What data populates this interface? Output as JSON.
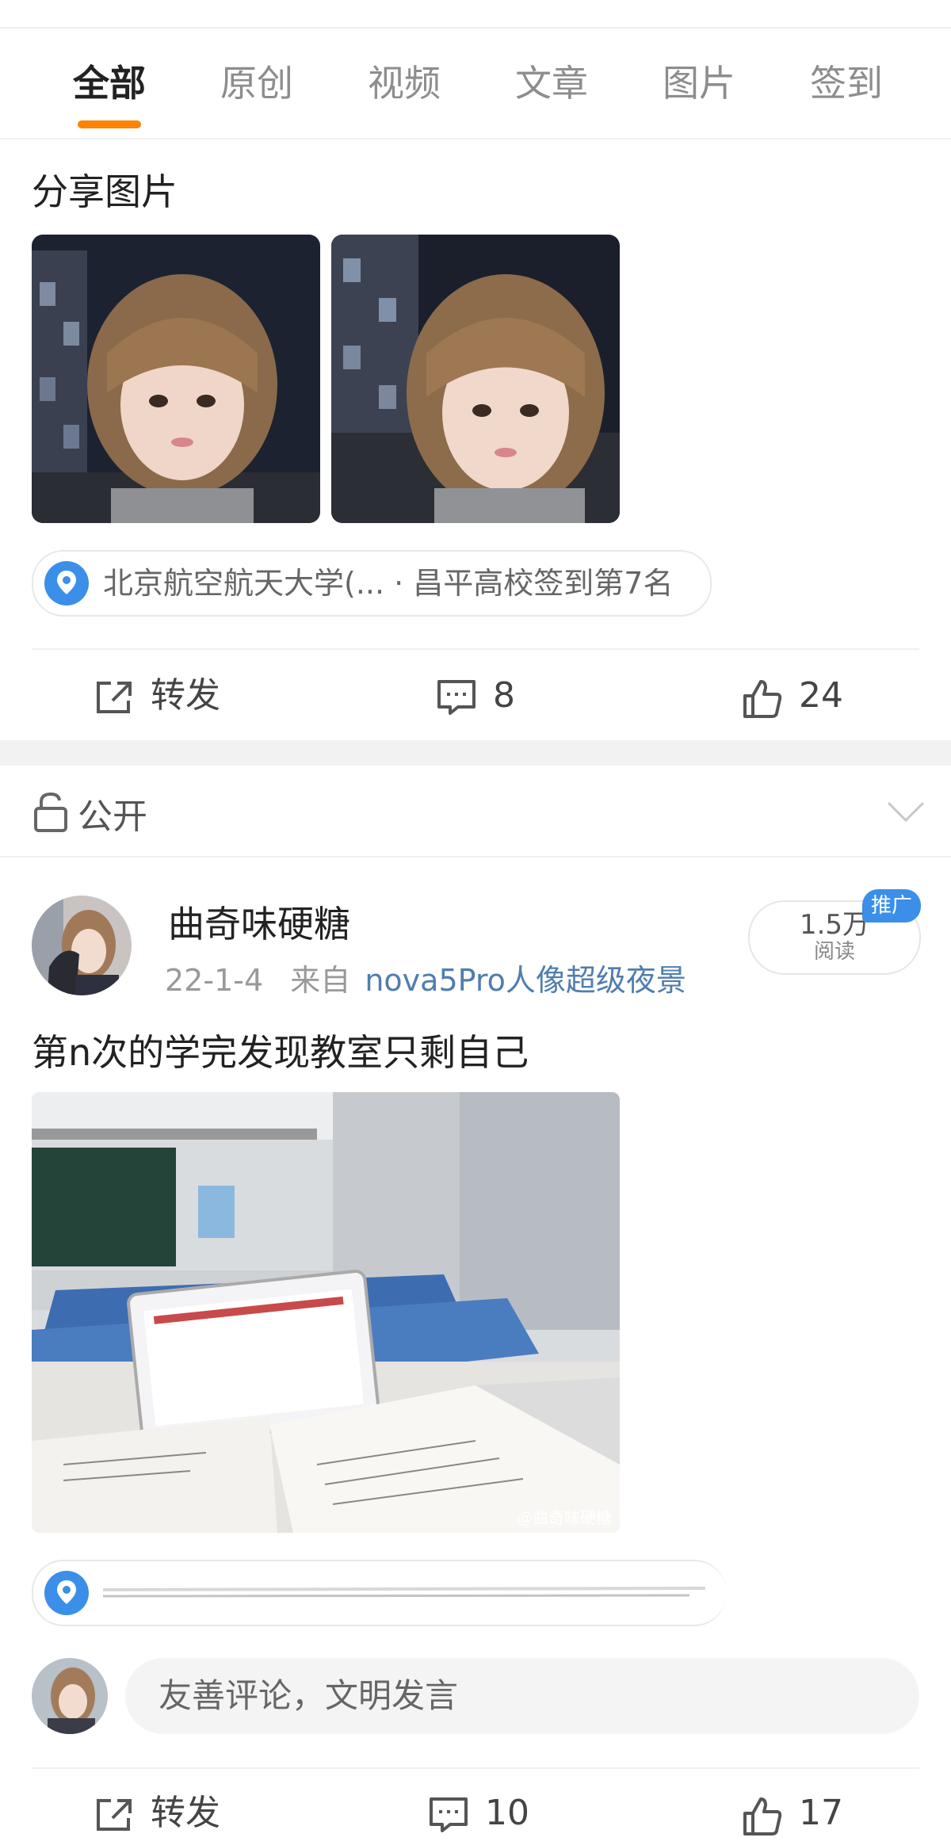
{
  "tabs": [
    {
      "label": "全部",
      "active": true
    },
    {
      "label": "原创",
      "active": false
    },
    {
      "label": "视频",
      "active": false
    },
    {
      "label": "文章",
      "active": false
    },
    {
      "label": "图片",
      "active": false
    },
    {
      "label": "签到",
      "active": false
    }
  ],
  "post1": {
    "text": "分享图片",
    "location": "北京航空航天大学(... · 昌平高校签到第7名",
    "actions": {
      "repost_label": "转发",
      "comments": "8",
      "likes": "24"
    }
  },
  "visibility": {
    "label": "公开"
  },
  "post2": {
    "author": "曲奇味硬糖",
    "date": "22-1-4",
    "from_prefix": "来自",
    "source": "nova5Pro人像超级夜景",
    "reads_count": "1.5万",
    "reads_label": "阅读",
    "promo_badge": "推广",
    "text": "第n次的学完发现教室只剩自己",
    "watermark": "@曲奇味硬糖",
    "comment_placeholder": "友善评论，文明发言",
    "actions": {
      "repost_label": "转发",
      "comments": "10",
      "likes": "17"
    }
  },
  "colors": {
    "accent": "#ff8200",
    "link": "#507daf",
    "pin": "#3b8fe8"
  }
}
